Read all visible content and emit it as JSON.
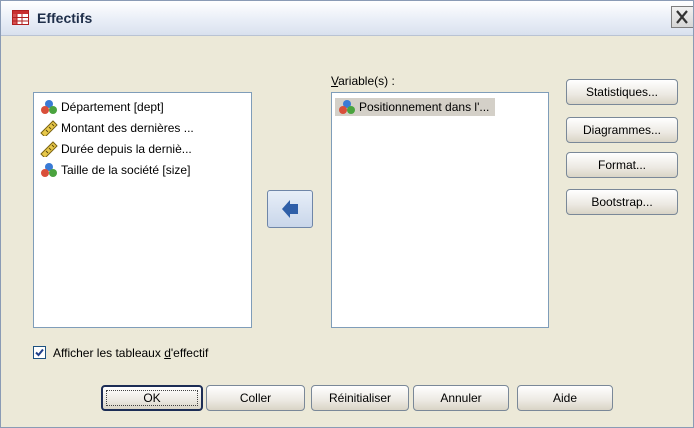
{
  "window": {
    "title": "Effectifs"
  },
  "source_list": {
    "items": [
      {
        "label": "Département [dept]",
        "icon": "nominal-icon"
      },
      {
        "label": "Montant des dernières ...",
        "icon": "scale-ruler-icon"
      },
      {
        "label": "Durée depuis la derniè...",
        "icon": "scale-ruler-icon"
      },
      {
        "label": "Taille de la société [size]",
        "icon": "nominal-icon"
      }
    ]
  },
  "target_list": {
    "label_prefix": "V",
    "label_rest": "ariable(s) :",
    "items": [
      {
        "label": "Positionnement dans l'...",
        "icon": "nominal-icon"
      }
    ]
  },
  "side_buttons": {
    "statistiques": "Statistiques...",
    "diagrammes": "Diagrammes...",
    "format": "Format...",
    "bootstrap": "Bootstrap..."
  },
  "checkbox": {
    "label_prefix": "Afficher les tableaux ",
    "label_underlined": "d",
    "label_rest": "'effectif",
    "checked": true
  },
  "bottom_buttons": {
    "ok": "OK",
    "coller": "Coller",
    "reinitialiser": "Réinitialiser",
    "annuler": "Annuler",
    "aide": "Aide"
  },
  "colors": {
    "title_text": "#1f2f4a",
    "dialog_bg": "#ece9d8",
    "list_border": "#7f9db9",
    "arrow_blue": "#2f5fa8"
  }
}
